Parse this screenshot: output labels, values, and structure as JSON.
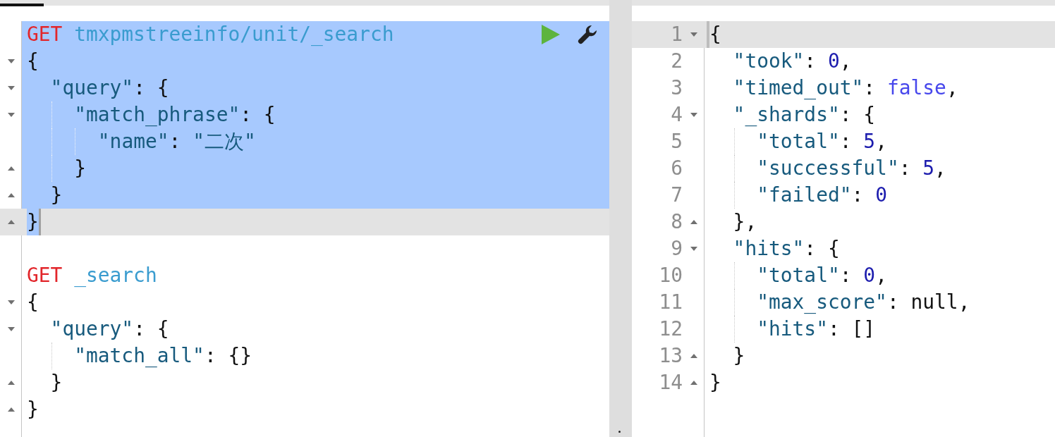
{
  "request_editor": {
    "lines": [
      {
        "fold_start": false,
        "fold_end": false,
        "selected": true,
        "active": false,
        "cursor": false,
        "toolbar": true,
        "tokens": [
          {
            "kind": "method",
            "s": "GET"
          },
          {
            "kind": "url",
            "s": " tmxpmstreeinfo/unit/_search"
          }
        ]
      },
      {
        "fold_start": true,
        "fold_end": false,
        "selected": true,
        "active": false,
        "cursor": false,
        "tokens": [
          {
            "kind": "punct",
            "s": "{"
          }
        ]
      },
      {
        "fold_start": true,
        "fold_end": false,
        "selected": true,
        "active": false,
        "cursor": false,
        "tokens": [
          {
            "kind": "key",
            "s": "  \"query\""
          },
          {
            "kind": "punct",
            "s": ": {"
          }
        ]
      },
      {
        "fold_start": true,
        "fold_end": false,
        "selected": true,
        "active": false,
        "cursor": false,
        "tokens": [
          {
            "kind": "key",
            "s": "    \"match_phrase\""
          },
          {
            "kind": "punct",
            "s": ": {"
          }
        ]
      },
      {
        "fold_start": false,
        "fold_end": false,
        "selected": true,
        "active": false,
        "cursor": false,
        "tokens": [
          {
            "kind": "key",
            "s": "      \"name\""
          },
          {
            "kind": "punct",
            "s": ": "
          },
          {
            "kind": "string",
            "s": "\"二次\""
          }
        ]
      },
      {
        "fold_start": false,
        "fold_end": true,
        "selected": true,
        "active": false,
        "cursor": false,
        "tokens": [
          {
            "kind": "punct",
            "s": "    }"
          }
        ]
      },
      {
        "fold_start": false,
        "fold_end": true,
        "selected": true,
        "active": false,
        "cursor": false,
        "tokens": [
          {
            "kind": "punct",
            "s": "  }"
          }
        ]
      },
      {
        "fold_start": false,
        "fold_end": true,
        "selected": true,
        "active": true,
        "cursor": true,
        "tokens": [
          {
            "kind": "punct",
            "s": "}"
          }
        ]
      },
      {
        "fold_start": false,
        "fold_end": false,
        "selected": false,
        "active": false,
        "cursor": false
      },
      {
        "fold_start": false,
        "fold_end": false,
        "selected": false,
        "active": false,
        "cursor": false,
        "tokens": [
          {
            "kind": "method",
            "s": "GET"
          },
          {
            "kind": "url",
            "s": " _search"
          }
        ]
      },
      {
        "fold_start": true,
        "fold_end": false,
        "selected": false,
        "active": false,
        "cursor": false,
        "tokens": [
          {
            "kind": "punct",
            "s": "{"
          }
        ]
      },
      {
        "fold_start": true,
        "fold_end": false,
        "selected": false,
        "active": false,
        "cursor": false,
        "tokens": [
          {
            "kind": "key",
            "s": "  \"query\""
          },
          {
            "kind": "punct",
            "s": ": {"
          }
        ]
      },
      {
        "fold_start": false,
        "fold_end": false,
        "selected": false,
        "active": false,
        "cursor": false,
        "tokens": [
          {
            "kind": "key",
            "s": "    \"match_all\""
          },
          {
            "kind": "punct",
            "s": ": {}"
          }
        ]
      },
      {
        "fold_start": false,
        "fold_end": true,
        "selected": false,
        "active": false,
        "cursor": false,
        "tokens": [
          {
            "kind": "punct",
            "s": "  }"
          }
        ]
      },
      {
        "fold_start": false,
        "fold_end": true,
        "selected": false,
        "active": false,
        "cursor": false,
        "tokens": [
          {
            "kind": "punct",
            "s": "}"
          }
        ]
      }
    ]
  },
  "response_viewer": {
    "lines": [
      {
        "number": "1",
        "fold_start": true,
        "fold_end": false,
        "active": true,
        "cursor": true,
        "tokens": [
          {
            "kind": "punct",
            "s": "{"
          }
        ]
      },
      {
        "number": "2",
        "fold_start": false,
        "fold_end": false,
        "active": false,
        "cursor": false,
        "tokens": [
          {
            "kind": "key",
            "s": "  \"took\""
          },
          {
            "kind": "punct",
            "s": ": "
          },
          {
            "kind": "number",
            "s": "0"
          },
          {
            "kind": "punct",
            "s": ","
          }
        ]
      },
      {
        "number": "3",
        "fold_start": false,
        "fold_end": false,
        "active": false,
        "cursor": false,
        "tokens": [
          {
            "kind": "key",
            "s": "  \"timed_out\""
          },
          {
            "kind": "punct",
            "s": ": "
          },
          {
            "kind": "boolean",
            "s": "false"
          },
          {
            "kind": "punct",
            "s": ","
          }
        ]
      },
      {
        "number": "4",
        "fold_start": true,
        "fold_end": false,
        "active": false,
        "cursor": false,
        "tokens": [
          {
            "kind": "key",
            "s": "  \"_shards\""
          },
          {
            "kind": "punct",
            "s": ": {"
          }
        ]
      },
      {
        "number": "5",
        "fold_start": false,
        "fold_end": false,
        "active": false,
        "cursor": false,
        "tokens": [
          {
            "kind": "key",
            "s": "    \"total\""
          },
          {
            "kind": "punct",
            "s": ": "
          },
          {
            "kind": "number",
            "s": "5"
          },
          {
            "kind": "punct",
            "s": ","
          }
        ]
      },
      {
        "number": "6",
        "fold_start": false,
        "fold_end": false,
        "active": false,
        "cursor": false,
        "tokens": [
          {
            "kind": "key",
            "s": "    \"successful\""
          },
          {
            "kind": "punct",
            "s": ": "
          },
          {
            "kind": "number",
            "s": "5"
          },
          {
            "kind": "punct",
            "s": ","
          }
        ]
      },
      {
        "number": "7",
        "fold_start": false,
        "fold_end": false,
        "active": false,
        "cursor": false,
        "tokens": [
          {
            "kind": "key",
            "s": "    \"failed\""
          },
          {
            "kind": "punct",
            "s": ": "
          },
          {
            "kind": "number",
            "s": "0"
          }
        ]
      },
      {
        "number": "8",
        "fold_start": false,
        "fold_end": true,
        "active": false,
        "cursor": false,
        "tokens": [
          {
            "kind": "punct",
            "s": "  },"
          }
        ]
      },
      {
        "number": "9",
        "fold_start": true,
        "fold_end": false,
        "active": false,
        "cursor": false,
        "tokens": [
          {
            "kind": "key",
            "s": "  \"hits\""
          },
          {
            "kind": "punct",
            "s": ": {"
          }
        ]
      },
      {
        "number": "10",
        "fold_start": false,
        "fold_end": false,
        "active": false,
        "cursor": false,
        "tokens": [
          {
            "kind": "key",
            "s": "    \"total\""
          },
          {
            "kind": "punct",
            "s": ": "
          },
          {
            "kind": "number",
            "s": "0"
          },
          {
            "kind": "punct",
            "s": ","
          }
        ]
      },
      {
        "number": "11",
        "fold_start": false,
        "fold_end": false,
        "active": false,
        "cursor": false,
        "tokens": [
          {
            "kind": "key",
            "s": "    \"max_score\""
          },
          {
            "kind": "punct",
            "s": ": "
          },
          {
            "kind": "null",
            "s": "null"
          },
          {
            "kind": "punct",
            "s": ","
          }
        ]
      },
      {
        "number": "12",
        "fold_start": false,
        "fold_end": false,
        "active": false,
        "cursor": false,
        "tokens": [
          {
            "kind": "key",
            "s": "    \"hits\""
          },
          {
            "kind": "punct",
            "s": ": []"
          }
        ]
      },
      {
        "number": "13",
        "fold_start": false,
        "fold_end": true,
        "active": false,
        "cursor": false,
        "tokens": [
          {
            "kind": "punct",
            "s": "  }"
          }
        ]
      },
      {
        "number": "14",
        "fold_start": false,
        "fold_end": true,
        "active": false,
        "cursor": false,
        "tokens": [
          {
            "kind": "punct",
            "s": "}"
          }
        ]
      }
    ]
  }
}
